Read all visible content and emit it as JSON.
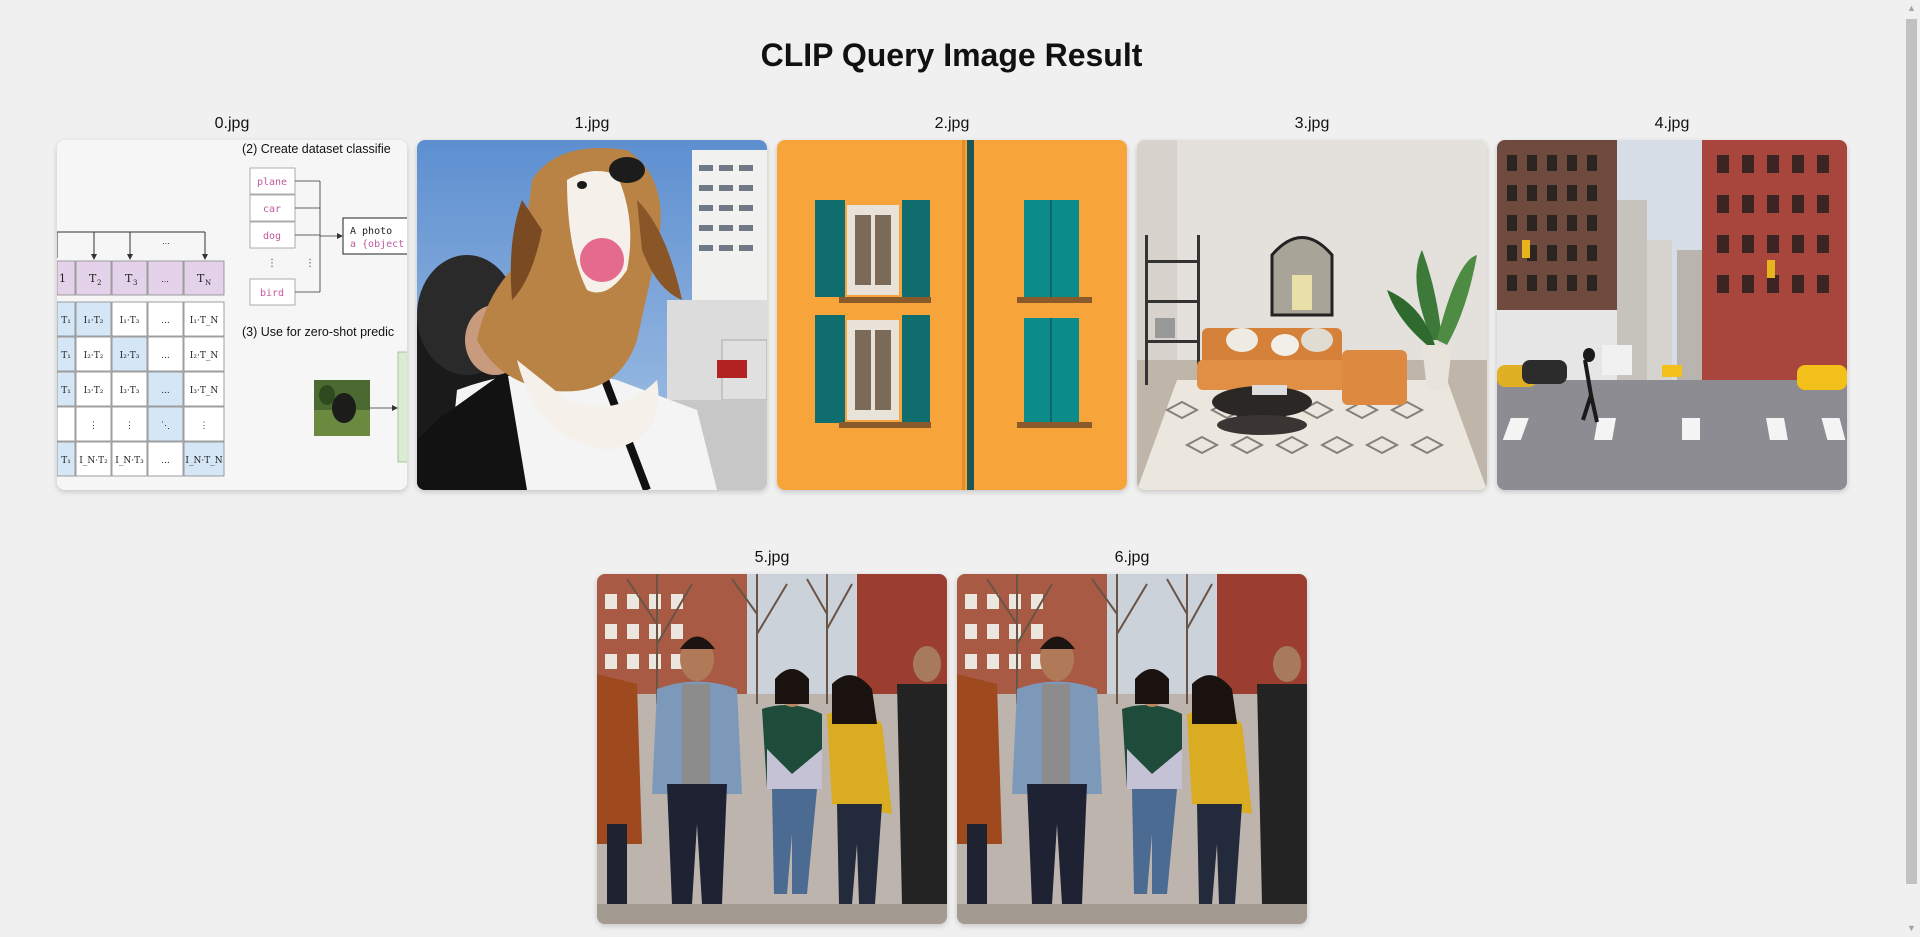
{
  "page": {
    "title": "CLIP Query Image Result"
  },
  "images": [
    {
      "caption": "0.jpg"
    },
    {
      "caption": "1.jpg"
    },
    {
      "caption": "2.jpg"
    },
    {
      "caption": "3.jpg"
    },
    {
      "caption": "4.jpg"
    },
    {
      "caption": "5.jpg"
    },
    {
      "caption": "6.jpg"
    }
  ],
  "diagram": {
    "step2": "(2) Create dataset classifie",
    "step3": "(3) Use for zero-shot predic",
    "labels": [
      "plane",
      "car",
      "dog",
      "bird"
    ],
    "prompt_line1": "A photo",
    "prompt_line2": "a {object",
    "ellipsis": "...",
    "vdots": "⋮",
    "ddots": "⋱",
    "text_headers": [
      "T",
      "T",
      "T",
      "...",
      "T"
    ],
    "text_subs": [
      "1",
      "2",
      "3",
      "",
      "N"
    ],
    "row_labels": [
      "T₁",
      "T₁",
      "T₁",
      "",
      "T₁"
    ],
    "matrix": [
      [
        "I₁·T₂",
        "I₁·T₃",
        "...",
        "I₁·T_N"
      ],
      [
        "I₂·T₂",
        "I₂·T₃",
        "...",
        "I₂·T_N"
      ],
      [
        "I₃·T₂",
        "I₃·T₃",
        "...",
        "I₃·T_N"
      ],
      [
        "⋮",
        "⋮",
        "⋱",
        "⋮"
      ],
      [
        "I_N·T₂",
        "I_N·T₃",
        "...",
        "I_N·T_N"
      ]
    ]
  },
  "colors": {
    "background": "#f0f0f0",
    "text_cell": "#e4d2ea",
    "image_cell": "#d5e6f7",
    "diag_label": "#c05a9b"
  }
}
